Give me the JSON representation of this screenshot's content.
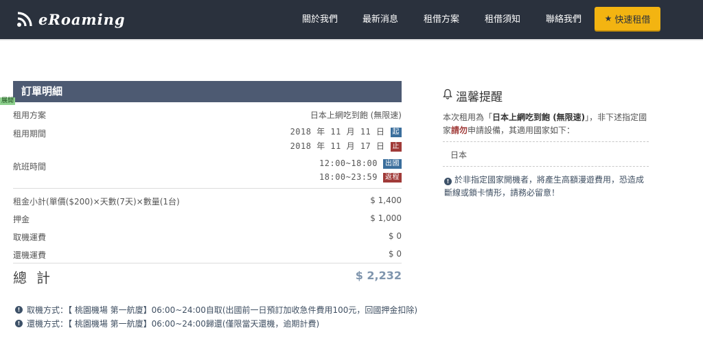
{
  "header": {
    "logo_text": "eRoaming",
    "nav": [
      "關於我們",
      "最新消息",
      "租借方案",
      "租借須知",
      "聯絡我們"
    ],
    "quick_button": "快速租借"
  },
  "order": {
    "title": "訂單明細",
    "expand_label": "展開",
    "plan_label": "租用方案",
    "plan_value": "日本上網吃到飽 (無限速)",
    "period_label": "租用期間",
    "period_start": "2018 年 11 月 11 日",
    "period_start_badge": "起",
    "period_end": "2018 年 11 月 17 日",
    "period_end_badge": "止",
    "flight_label": "航班時間",
    "flight_out": "12:00~18:00",
    "flight_out_badge": "出國",
    "flight_back": "18:00~23:59",
    "flight_back_badge": "返程",
    "subtotal_label": "租金小計(單價($200)×天數(7天)×數量(1台)",
    "subtotal_value": "$ 1,400",
    "deposit_label": "押金",
    "deposit_value": "$ 1,000",
    "pickup_fee_label": "取機運費",
    "pickup_fee_value": "$ 0",
    "return_fee_label": "還機運費",
    "return_fee_value": "$ 0",
    "total_label": "總計",
    "total_value": "$ 2,232"
  },
  "notes": {
    "pickup": "取機方式：【 桃園機場 第一航廈】06:00~24:00自取(出國前一日預訂加收急件費用100元，回國押金扣除)",
    "return": "還機方式：【 桃園機場 第一航廈】06:00~24:00歸還(僅限當天還機，逾期計費)"
  },
  "reminder": {
    "title": "溫馨提醒",
    "body_pre": "本次租用為「",
    "body_plan": "日本上網吃到飽 (無限速)",
    "body_mid": "」，非下述指定國家",
    "body_red": "請勿",
    "body_post": "申請設備，其適用國家如下：",
    "country": "日本",
    "warning": "於非指定國家開機者，將產生高額漫遊費用，恐造成斷線或鎖卡情形，請務必留意！"
  },
  "colors": {
    "header_bg": "#2a313d",
    "accent_yellow": "#f3b411",
    "order_head_bg": "#4d5a72",
    "badge_blue": "#3a6e9c",
    "badge_red": "#a03a38",
    "total_color": "#7f95ad"
  },
  "icons": {
    "logo": "wifi-signal-icon",
    "quick_button": "star-icon",
    "reminder": "bell-icon",
    "notes": "info-circle-icon"
  }
}
